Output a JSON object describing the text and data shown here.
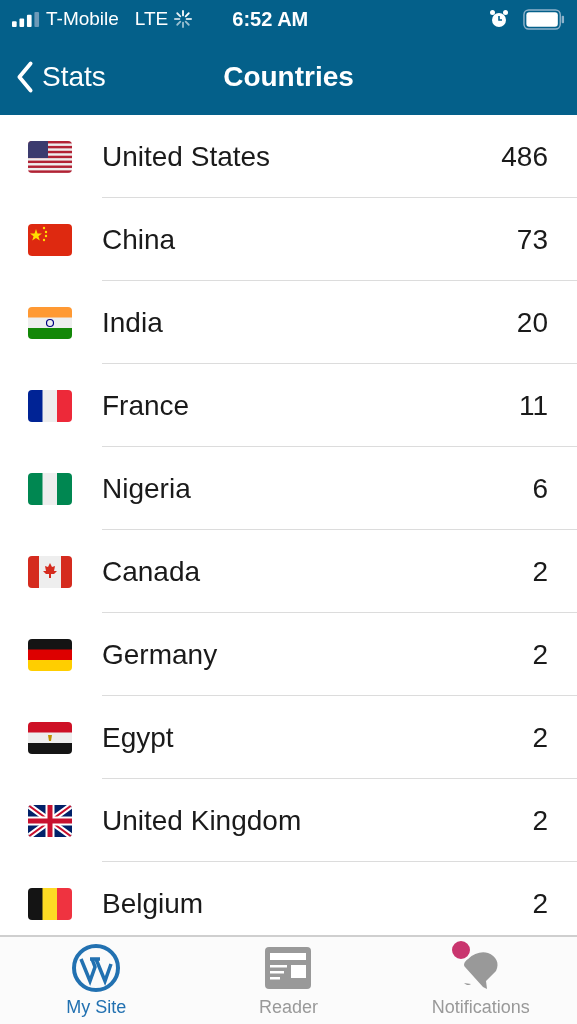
{
  "status_bar": {
    "carrier": "T-Mobile",
    "network": "LTE",
    "time": "6:52 AM"
  },
  "nav": {
    "back": "Stats",
    "title": "Countries"
  },
  "rows": [
    {
      "kind": "us",
      "country": "United States",
      "count": "486"
    },
    {
      "kind": "cn",
      "country": "China",
      "count": "73"
    },
    {
      "kind": "in",
      "country": "India",
      "count": "20"
    },
    {
      "kind": "fr",
      "country": "France",
      "count": "11"
    },
    {
      "kind": "ng",
      "country": "Nigeria",
      "count": "6"
    },
    {
      "kind": "ca",
      "country": "Canada",
      "count": "2"
    },
    {
      "kind": "de",
      "country": "Germany",
      "count": "2"
    },
    {
      "kind": "eg",
      "country": "Egypt",
      "count": "2"
    },
    {
      "kind": "gb",
      "country": "United Kingdom",
      "count": "2"
    },
    {
      "kind": "be",
      "country": "Belgium",
      "count": "2"
    }
  ],
  "tabs": [
    {
      "kind": "site",
      "label": "My Site",
      "selected": true,
      "badge": false
    },
    {
      "kind": "reader",
      "label": "Reader",
      "selected": false,
      "badge": false
    },
    {
      "kind": "notifications",
      "label": "Notifications",
      "selected": false,
      "badge": true
    }
  ]
}
